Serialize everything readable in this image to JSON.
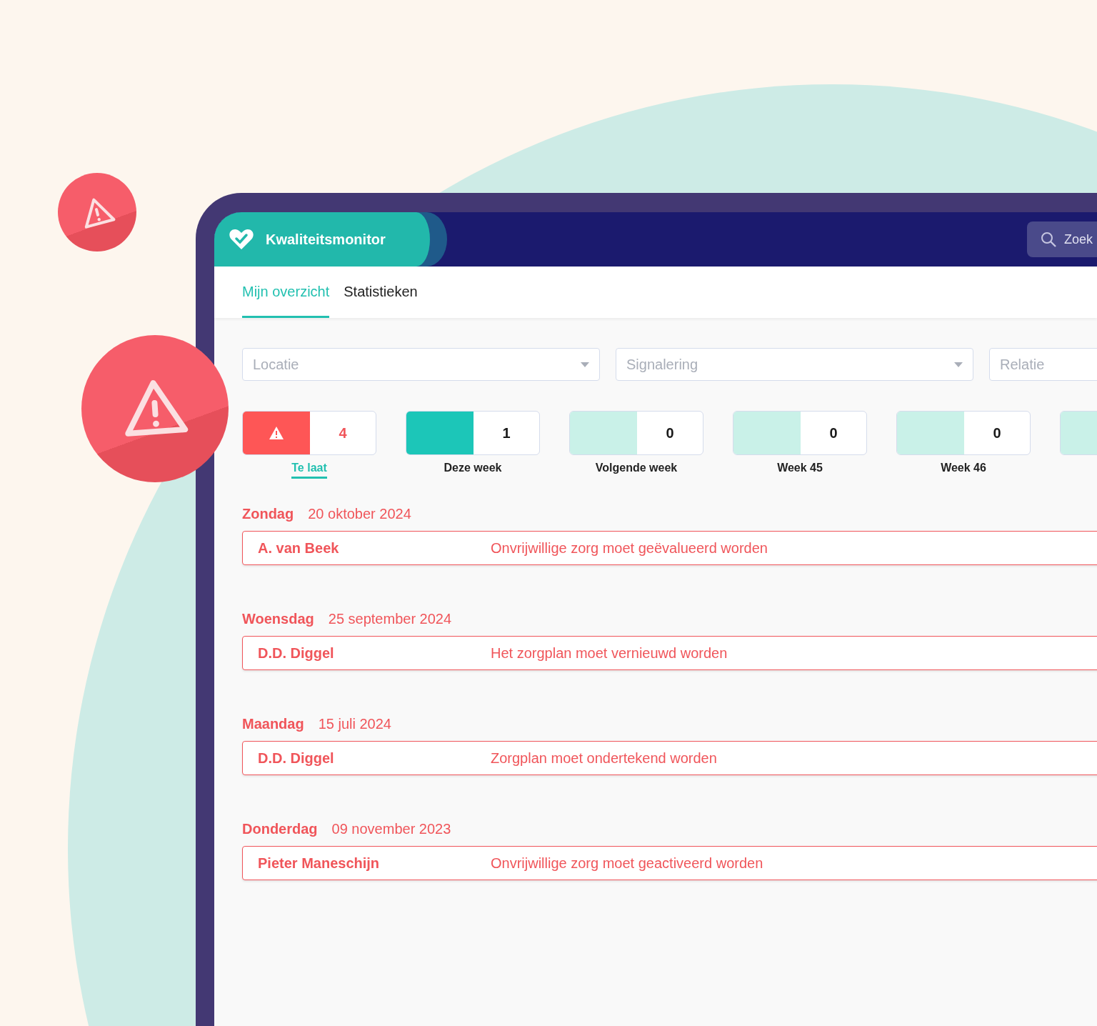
{
  "app": {
    "title": "Kwaliteitsmonitor",
    "search": {
      "placeholder": "Zoek"
    }
  },
  "tabs": [
    {
      "label": "Mijn overzicht",
      "selected": true
    },
    {
      "label": "Statistieken",
      "selected": false
    }
  ],
  "filters": [
    {
      "placeholder": "Locatie"
    },
    {
      "placeholder": "Signalering"
    },
    {
      "placeholder": "Relatie"
    }
  ],
  "counters": [
    {
      "kind": "late",
      "count": "4",
      "label": "Te laat",
      "selected": true
    },
    {
      "kind": "current",
      "count": "1",
      "label": "Deze week",
      "selected": false
    },
    {
      "kind": "future",
      "count": "0",
      "label": "Volgende week",
      "selected": false
    },
    {
      "kind": "future",
      "count": "0",
      "label": "Week 45",
      "selected": false
    },
    {
      "kind": "future",
      "count": "0",
      "label": "Week 46",
      "selected": false
    },
    {
      "kind": "future"
    }
  ],
  "groups": [
    {
      "day": "Zondag",
      "date": "20 oktober 2024",
      "items": [
        {
          "name": "A. van Beek",
          "message": "Onvrijwillige zorg moet geëvalueerd worden"
        }
      ]
    },
    {
      "day": "Woensdag",
      "date": "25 september 2024",
      "items": [
        {
          "name": "D.D. Diggel",
          "message": "Het zorgplan moet vernieuwd worden"
        }
      ]
    },
    {
      "day": "Maandag",
      "date": "15 juli 2024",
      "items": [
        {
          "name": "D.D. Diggel",
          "message": "Zorgplan moet ondertekend worden"
        }
      ]
    },
    {
      "day": "Donderdag",
      "date": "09 november 2023",
      "items": [
        {
          "name": "Pieter Maneschijn",
          "message": "Onvrijwillige zorg moet geactiveerd worden"
        }
      ]
    }
  ]
}
